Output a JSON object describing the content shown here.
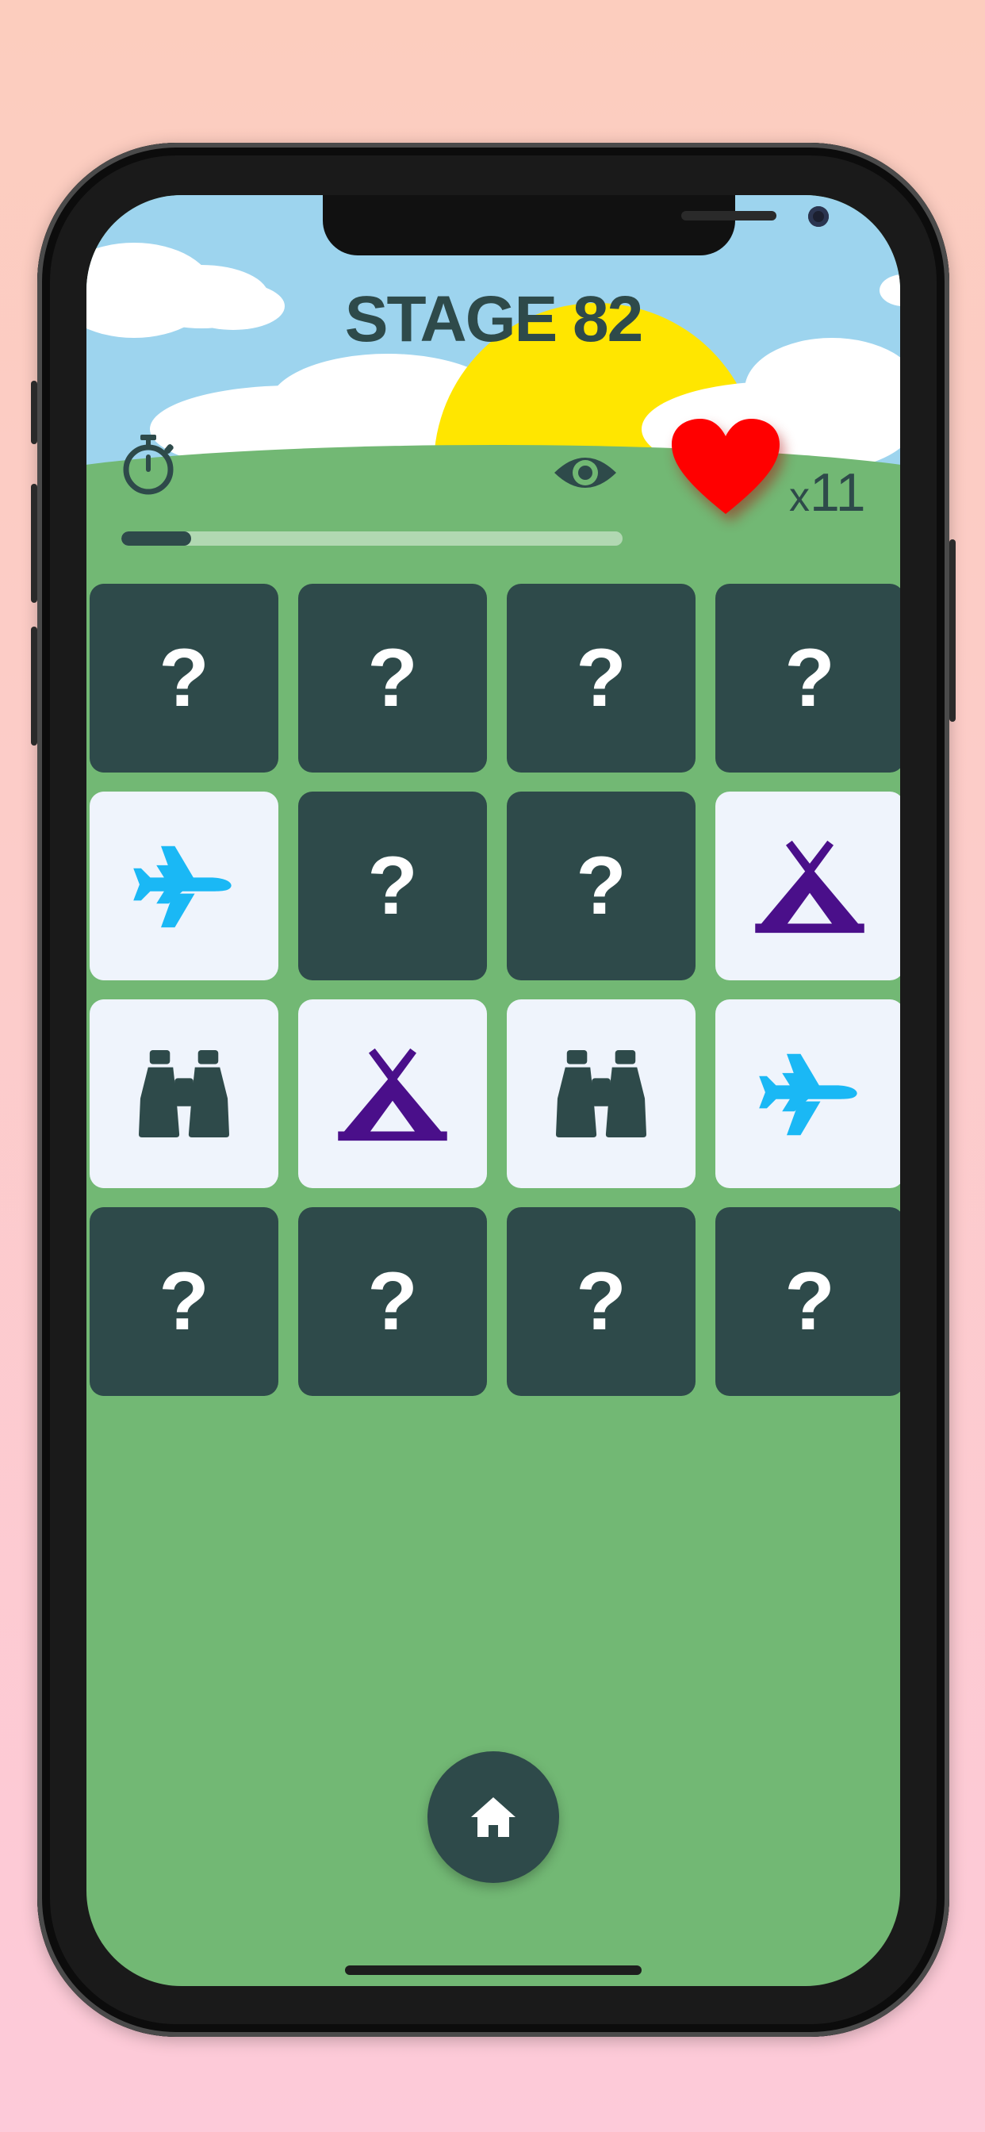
{
  "header": {
    "stage_title": "STAGE 82",
    "lives_prefix": "x",
    "lives_count": "11"
  },
  "progress": {
    "fraction": 0.14
  },
  "icons": {
    "timer": "stopwatch-icon",
    "reveal": "eye-icon",
    "lives": "heart-icon",
    "home": "home-icon"
  },
  "board": {
    "rows": 4,
    "cols": 4,
    "cards": [
      {
        "state": "hidden",
        "label": "?"
      },
      {
        "state": "hidden",
        "label": "?"
      },
      {
        "state": "hidden",
        "label": "?"
      },
      {
        "state": "hidden",
        "label": "?"
      },
      {
        "state": "revealed",
        "icon": "airplane-icon"
      },
      {
        "state": "hidden",
        "label": "?"
      },
      {
        "state": "hidden",
        "label": "?"
      },
      {
        "state": "revealed",
        "icon": "tent-icon"
      },
      {
        "state": "revealed",
        "icon": "binoculars-icon"
      },
      {
        "state": "revealed",
        "icon": "tent-icon"
      },
      {
        "state": "revealed",
        "icon": "binoculars-icon"
      },
      {
        "state": "revealed",
        "icon": "airplane-icon"
      },
      {
        "state": "hidden",
        "label": "?"
      },
      {
        "state": "hidden",
        "label": "?"
      },
      {
        "state": "hidden",
        "label": "?"
      },
      {
        "state": "hidden",
        "label": "?"
      }
    ]
  },
  "colors": {
    "card_hidden": "#2e4a4a",
    "card_revealed": "#eff4fc",
    "airplane": "#1ab8f5",
    "tent": "#4a0f8a",
    "binoculars": "#2e4a4a",
    "heart": "#ff0000",
    "grass": "#72b874",
    "sky": "#9dd4ee",
    "sun": "#ffe600"
  }
}
